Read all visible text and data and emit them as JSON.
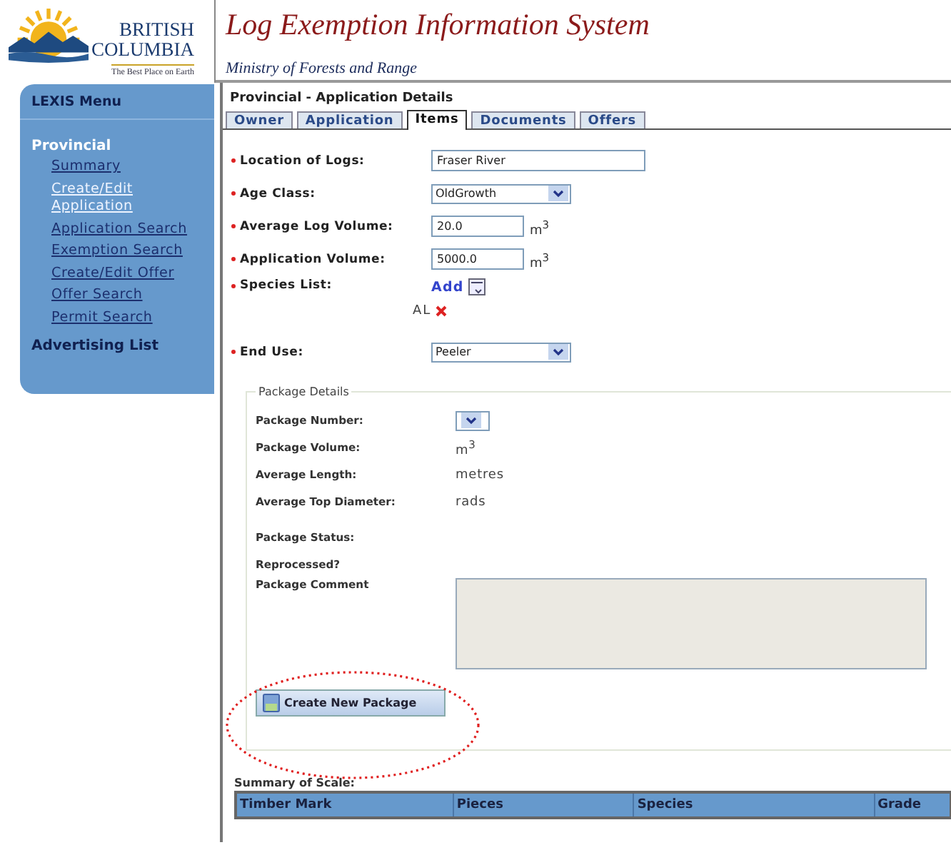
{
  "header": {
    "logo": {
      "line1": "BRITISH",
      "line2": "COLUMBIA",
      "tagline": "The Best Place on Earth"
    },
    "title": "Log Exemption Information System",
    "subtitle": "Ministry of Forests and Range"
  },
  "sidebar": {
    "title": "LEXIS Menu",
    "sections": [
      {
        "label": "Provincial",
        "items": [
          {
            "label": "Summary",
            "selected": false
          },
          {
            "label": "Create/Edit Application",
            "selected": true
          },
          {
            "label": "Application Search",
            "selected": false
          },
          {
            "label": "Exemption Search",
            "selected": false
          },
          {
            "label": "Create/Edit Offer",
            "selected": false
          },
          {
            "label": "Offer Search",
            "selected": false
          },
          {
            "label": "Permit Search",
            "selected": false
          }
        ]
      },
      {
        "label": "Advertising List"
      }
    ]
  },
  "page_title": "Provincial - Application Details",
  "tabs": [
    {
      "label": "Owner",
      "selected": false
    },
    {
      "label": "Application",
      "selected": false
    },
    {
      "label": "Items",
      "selected": true
    },
    {
      "label": "Documents",
      "selected": false
    },
    {
      "label": "Offers",
      "selected": false
    }
  ],
  "fields": [
    {
      "label": "Location of Logs:",
      "required": true,
      "kind": "text",
      "value": "Fraser River"
    },
    {
      "label": "Age Class:",
      "required": true,
      "kind": "select",
      "value": "OldGrowth"
    },
    {
      "label": "Average Log Volume:",
      "required": true,
      "kind": "number",
      "value": "20.0",
      "unit": "m$^{3}$"
    },
    {
      "label": "Application Volume:",
      "required": true,
      "kind": "number",
      "value": "5000.0",
      "unit": "m$^{3}$"
    },
    {
      "label": "Species List:",
      "required": true,
      "kind": "species",
      "action": "Add",
      "species": [
        "AL"
      ]
    },
    {
      "label": "End Use:",
      "required": true,
      "kind": "select",
      "value": "Peeler"
    }
  ],
  "package": {
    "legend": "Package Details",
    "rows": [
      {
        "label": "Package Number:",
        "kind": "select"
      },
      {
        "label": "Package Volume:",
        "kind": "text",
        "value": "m$^{3}$"
      },
      {
        "label": "Average Length:",
        "kind": "text",
        "value": "metres"
      },
      {
        "label": "Average Top Diameter:",
        "kind": "text",
        "value": "rads"
      },
      {
        "label": "Package Status:",
        "kind": "text"
      },
      {
        "label": "Reprocessed?",
        "kind": "text"
      },
      {
        "label": "Package Comment",
        "kind": "textarea"
      }
    ],
    "button": "Create New Package"
  },
  "summary": {
    "title": "Summary of Scale:",
    "columns": [
      "Timber Mark",
      "Pieces",
      "Species",
      "Grade"
    ]
  }
}
